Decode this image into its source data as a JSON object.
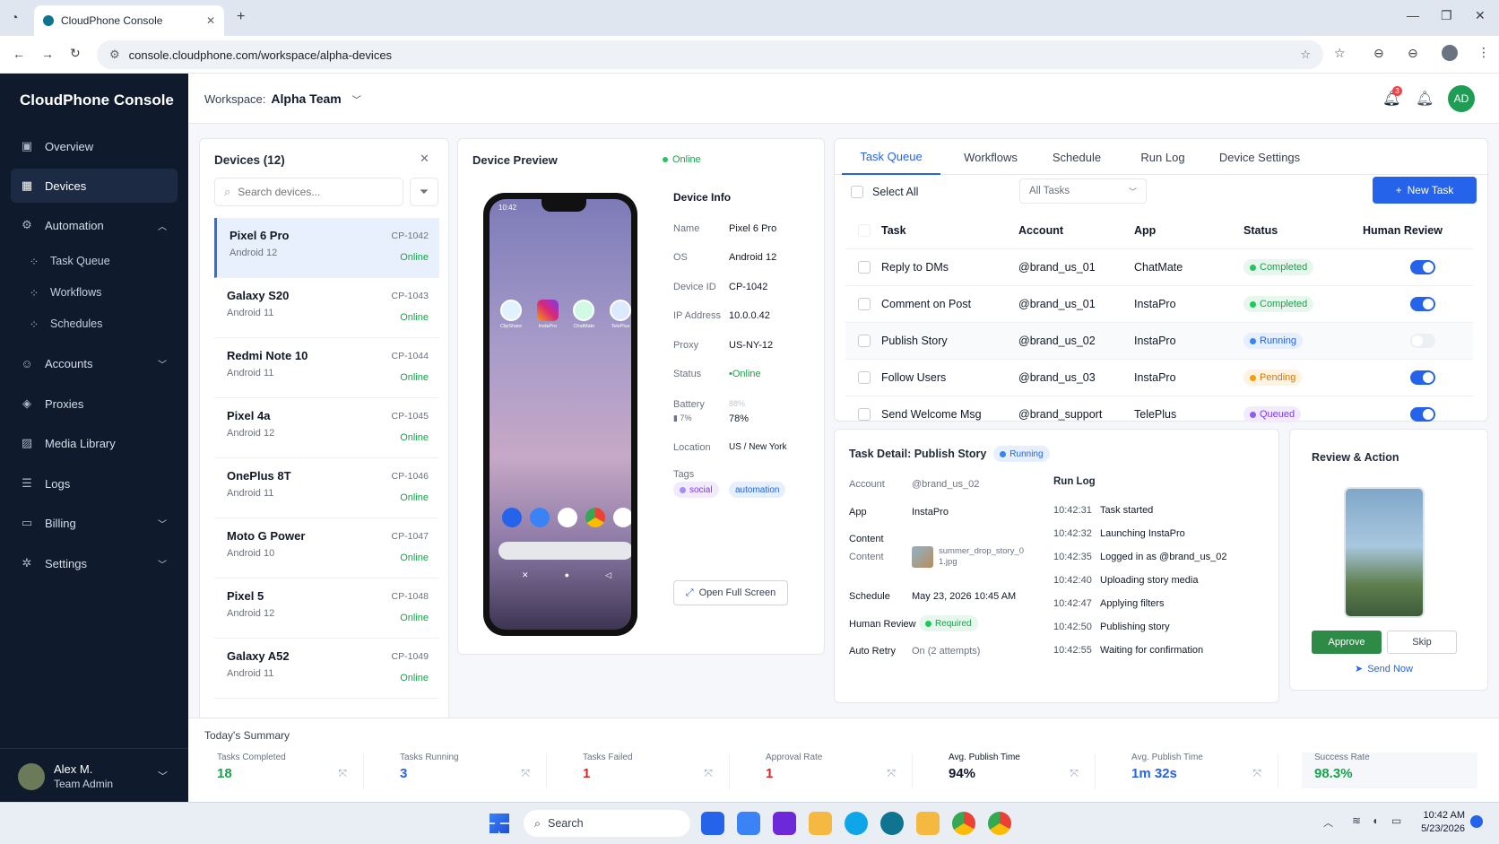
{
  "browser": {
    "tab_title": "CloudPhone Console",
    "url": "console.cloudphone.com/workspace/alpha-devices"
  },
  "app": {
    "name": "CloudPhone Console"
  },
  "sidebar": {
    "items": [
      {
        "label": "Overview",
        "icon": "overview-icon"
      },
      {
        "label": "Devices",
        "icon": "devices-icon"
      },
      {
        "label": "Automation",
        "icon": "automation-icon"
      },
      {
        "label": "Accounts",
        "icon": "accounts-icon"
      },
      {
        "label": "Proxies",
        "icon": "proxies-icon"
      },
      {
        "label": "Media Library",
        "icon": "media-icon"
      },
      {
        "label": "Logs",
        "icon": "logs-icon"
      },
      {
        "label": "Billing",
        "icon": "billing-icon"
      },
      {
        "label": "Settings",
        "icon": "settings-icon"
      }
    ],
    "automation_sub": [
      "Task Queue",
      "Workflows",
      "Schedules"
    ],
    "user": {
      "name": "Alex M.",
      "role": "Team Admin"
    }
  },
  "topbar": {
    "workspace_label": "Workspace:",
    "workspace_name": "Alpha Team",
    "notif_count": "3",
    "avatar": "AD"
  },
  "devices": {
    "title": "Devices (12)",
    "search_placeholder": "Search devices...",
    "list": [
      {
        "name": "Pixel 6 Pro",
        "os": "Android 12",
        "id": "CP-1042",
        "status": "Online"
      },
      {
        "name": "Galaxy S20",
        "os": "Android 11",
        "id": "CP-1043",
        "status": "Online"
      },
      {
        "name": "Redmi Note 10",
        "os": "Android 11",
        "id": "CP-1044",
        "status": "Online"
      },
      {
        "name": "Pixel 4a",
        "os": "Android 12",
        "id": "CP-1045",
        "status": "Online"
      },
      {
        "name": "OnePlus 8T",
        "os": "Android 11",
        "id": "CP-1046",
        "status": "Online"
      },
      {
        "name": "Moto G Power",
        "os": "Android 10",
        "id": "CP-1047",
        "status": "Online"
      },
      {
        "name": "Pixel 5",
        "os": "Android 12",
        "id": "CP-1048",
        "status": "Online"
      },
      {
        "name": "Galaxy A52",
        "os": "Android 11",
        "id": "CP-1049",
        "status": "Online"
      }
    ]
  },
  "preview": {
    "title": "Device Preview",
    "status": "Online",
    "phone_time": "10:42",
    "apps": [
      "ClipShare",
      "InstaPro",
      "ChatMate",
      "TelePlus"
    ],
    "info_title": "Device Info",
    "info": {
      "name_label": "Name",
      "name": "Pixel 6 Pro",
      "os_label": "OS",
      "os": "Android 12",
      "id_label": "Device ID",
      "id": "CP-1042",
      "ip_label": "IP Address",
      "ip": "10.0.0.42",
      "proxy_label": "Proxy",
      "proxy": "US-NY-12",
      "status_label": "Status",
      "status": "•Online",
      "battery_label": "Battery",
      "battery_sub": "7%",
      "battery_faded": "88%",
      "battery": "78%",
      "location_label": "Location",
      "location": "US / New York",
      "tags_label": "Tags",
      "tag1": "social",
      "tag2": "automation"
    },
    "open_full": "Open Full Screen"
  },
  "tasks": {
    "tabs": [
      "Task Queue",
      "Workflows",
      "Schedule",
      "Run Log",
      "Device Settings"
    ],
    "select_all": "Select All",
    "filter": "All Tasks",
    "new_task": "New Task",
    "headers": [
      "Task",
      "Account",
      "App",
      "Status",
      "Human Review"
    ],
    "rows": [
      {
        "task": "Reply to DMs",
        "account": "@brand_us_01",
        "app": "ChatMate",
        "status": "Completed",
        "review": true
      },
      {
        "task": "Comment on Post",
        "account": "@brand_us_01",
        "app": "InstaPro",
        "status": "Completed",
        "review": true
      },
      {
        "task": "Publish Story",
        "account": "@brand_us_02",
        "app": "InstaPro",
        "status": "Running",
        "review": false
      },
      {
        "task": "Follow Users",
        "account": "@brand_us_03",
        "app": "InstaPro",
        "status": "Pending",
        "review": true
      },
      {
        "task": "Send Welcome Msg",
        "account": "@brand_support",
        "app": "TelePlus",
        "status": "Queued",
        "review": true
      }
    ]
  },
  "detail": {
    "title": "Task Detail: Publish Story",
    "badge": "Running",
    "account_label": "Account",
    "account": "@brand_us_02",
    "app_label": "App",
    "app": "InstaPro",
    "content_head": "Content",
    "content_label": "Content",
    "content_file": "summer_drop_story_01.jpg",
    "schedule_label": "Schedule",
    "schedule": "May 23, 2026 10:45 AM",
    "review_label": "Human Review",
    "review": "Required",
    "retry_label": "Auto Retry",
    "retry": "On (2 attempts)",
    "runlog_title": "Run Log",
    "log": [
      {
        "t": "10:42:31",
        "m": "Task started"
      },
      {
        "t": "10:42:32",
        "m": "Launching InstaPro"
      },
      {
        "t": "10:42:35",
        "m": "Logged in as @brand_us_02"
      },
      {
        "t": "10:42:40",
        "m": "Uploading story media"
      },
      {
        "t": "10:42:47",
        "m": "Applying filters"
      },
      {
        "t": "10:42:50",
        "m": "Publishing story"
      },
      {
        "t": "10:42:55",
        "m": "Waiting for confirmation"
      }
    ]
  },
  "review": {
    "title": "Review & Action",
    "approve": "Approve",
    "skip": "Skip",
    "send_now": "Send Now"
  },
  "summary": {
    "title": "Today's Summary",
    "items": [
      {
        "label": "Tasks Completed",
        "value": "18",
        "color": "#16a34a"
      },
      {
        "label": "Tasks Running",
        "value": "3",
        "color": "#2563eb"
      },
      {
        "label": "Tasks Failed",
        "value": "1",
        "color": "#dc2626"
      },
      {
        "label": "Approval Rate",
        "value": "1",
        "color": "#dc2626"
      },
      {
        "label": "Avg. Publish Time",
        "value": "94%",
        "color": "#111827"
      },
      {
        "label": "Avg. Publish Time",
        "value": "1m 32s",
        "color": "#2563eb"
      },
      {
        "label": "Success Rate",
        "value": "98.3%",
        "color": "#16a34a"
      }
    ]
  },
  "taskbar": {
    "search": "Search",
    "time": "10:42 AM",
    "date": "5/23/2026"
  },
  "colors": {
    "accent": "#2563eb",
    "sidebar": "#0f1b2d",
    "approve": "#2e8b47"
  }
}
